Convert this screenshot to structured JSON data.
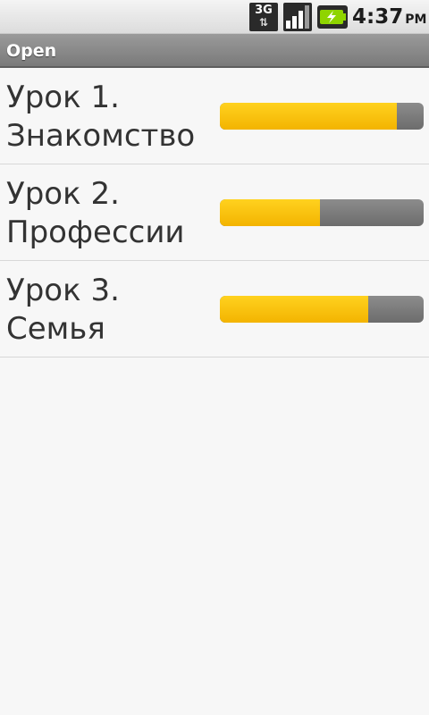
{
  "status_bar": {
    "network": "3G",
    "network_icon": "3g-data-icon",
    "signal_icon": "signal-strength-icon",
    "battery_icon": "battery-charging-icon",
    "time": "4:37",
    "ampm": "PM"
  },
  "title_bar": {
    "title": "Open"
  },
  "lessons": [
    {
      "line1": "Урок 1.",
      "line2": "Знакомство",
      "progress": 0.87
    },
    {
      "line1": "Урок 2.",
      "line2": "Профессии",
      "progress": 0.49
    },
    {
      "line1": "Урок 3.",
      "line2": "Семья",
      "progress": 0.73
    }
  ],
  "colors": {
    "progress_fill": "#f5b800",
    "progress_track": "#7a7a7a",
    "background": "#f7f7f7",
    "title_bar": "#8a8a8a"
  }
}
